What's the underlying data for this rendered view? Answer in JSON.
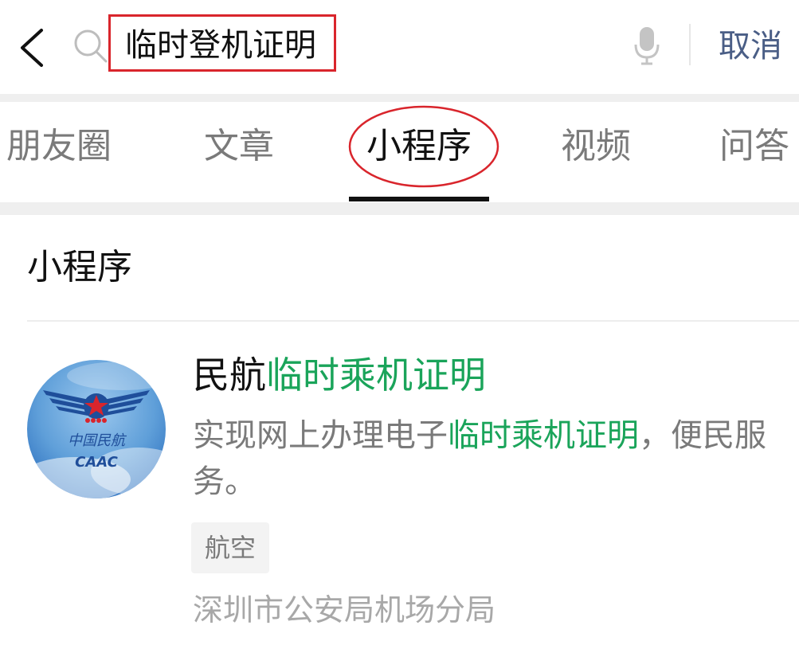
{
  "search": {
    "query": "临时登机证明",
    "cancel_label": "取消"
  },
  "tabs": [
    {
      "label": "朋友圈",
      "active": false
    },
    {
      "label": "文章",
      "active": false
    },
    {
      "label": "小程序",
      "active": true
    },
    {
      "label": "视频",
      "active": false
    },
    {
      "label": "问答",
      "active": false
    }
  ],
  "section": {
    "title": "小程序"
  },
  "result": {
    "title_prefix": "民航",
    "title_highlight": "临时乘机证明",
    "desc_part1": "实现网上办理电子",
    "desc_highlight": "临时乘机证明",
    "desc_part2": "，便民服务。",
    "tag": "航空",
    "source": "深圳市公安局机场分局",
    "logo": {
      "text_cn": "中国民航",
      "text_en": "CAAC"
    }
  },
  "colors": {
    "highlight": "#1aa45a",
    "annotation_red": "#d9252c",
    "cancel_blue": "#4a5e86"
  },
  "icons": [
    "back-chevron-icon",
    "search-icon",
    "microphone-icon"
  ]
}
